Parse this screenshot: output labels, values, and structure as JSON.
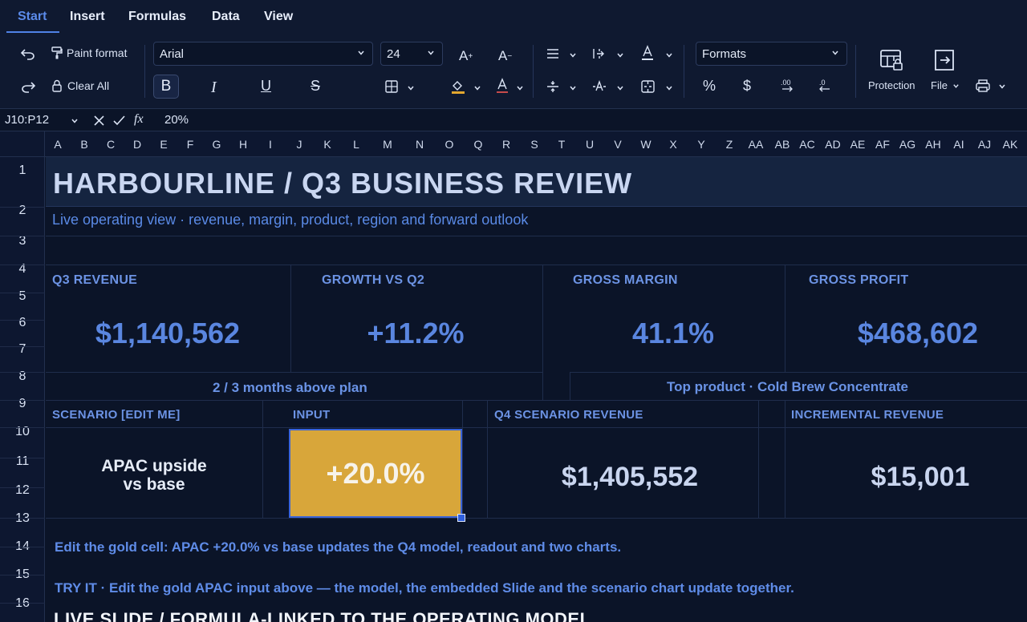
{
  "menu": {
    "tabs": [
      {
        "label": "Start",
        "active": true
      },
      {
        "label": "Insert",
        "active": false
      },
      {
        "label": "Formulas",
        "active": false
      },
      {
        "label": "Data",
        "active": false
      },
      {
        "label": "View",
        "active": false
      }
    ]
  },
  "ribbon": {
    "paint_format": "Paint format",
    "clear_all": "Clear All",
    "font_family": "Arial",
    "font_size": "24",
    "bold": "B",
    "italic": "I",
    "underline": "U",
    "strike": "S",
    "number_format": "Formats",
    "percent": "%",
    "currency": "$",
    "protection": "Protection",
    "file": "File",
    "icons": [
      "undo-icon",
      "redo-icon",
      "paint-format-icon",
      "lock-icon",
      "increase-font-icon",
      "decrease-font-icon",
      "borders-icon",
      "fill-color-icon",
      "font-color-icon",
      "align-icon",
      "merge-icon",
      "text-color-icon",
      "protection-icon",
      "file-export-icon",
      "print-icon"
    ]
  },
  "formula_bar": {
    "name_box": "J10:P12",
    "fx": "fx",
    "value": "20%"
  },
  "columns": [
    "A",
    "B",
    "C",
    "D",
    "E",
    "F",
    "G",
    "H",
    "I",
    "J",
    "K",
    "L",
    "M",
    "N",
    "O",
    "Q",
    "R",
    "S",
    "T",
    "U",
    "V",
    "W",
    "X",
    "Y",
    "Z",
    "AA",
    "AB",
    "AC",
    "AD",
    "AE",
    "AF",
    "AG",
    "AH",
    "AI",
    "AJ",
    "AK"
  ],
  "rows": [
    "1",
    "2",
    "3",
    "4",
    "5",
    "6",
    "7",
    "8",
    "9",
    "10",
    "11",
    "12",
    "13",
    "14",
    "15",
    "16"
  ],
  "sheet": {
    "title": "HARBOURLINE  /  Q3 BUSINESS REVIEW",
    "subtitle": "Live operating view  ·  revenue, margin, product, region and forward outlook",
    "kpis": [
      {
        "label": "Q3 REVENUE",
        "value": "$1,140,562"
      },
      {
        "label": "GROWTH VS Q2",
        "value": "+11.2%"
      },
      {
        "label": "GROSS MARGIN",
        "value": "41.1%"
      },
      {
        "label": "GROSS PROFIT",
        "value": "$468,602"
      }
    ],
    "plan_note": "2 / 3 months above plan",
    "top_product": "Top product   ·   Cold Brew Concentrate",
    "scenario": {
      "label": "SCENARIO   [EDIT ME]",
      "text_line1": "APAC upside",
      "text_line2": "vs base",
      "input_label": "INPUT",
      "input_value": "+20.0%",
      "q4_label": "Q4 SCENARIO REVENUE",
      "q4_value": "$1,405,552",
      "inc_label": "INCREMENTAL REVENUE",
      "inc_value": "$15,001"
    },
    "edit_note": "Edit the gold cell: APAC +20.0% vs base updates the Q4 model, readout and two charts.",
    "try_it": "TRY IT   ·   Edit the gold APAC input above — the model, the embedded Slide and the scenario chart update together.",
    "live_slide": "LIVE SLIDE  /  FORMULA-LINKED TO THE OPERATING MODEL",
    "colors": {
      "accent": "#5b8bea",
      "gold": "#d8a63a",
      "bg": "#0b1428"
    }
  }
}
